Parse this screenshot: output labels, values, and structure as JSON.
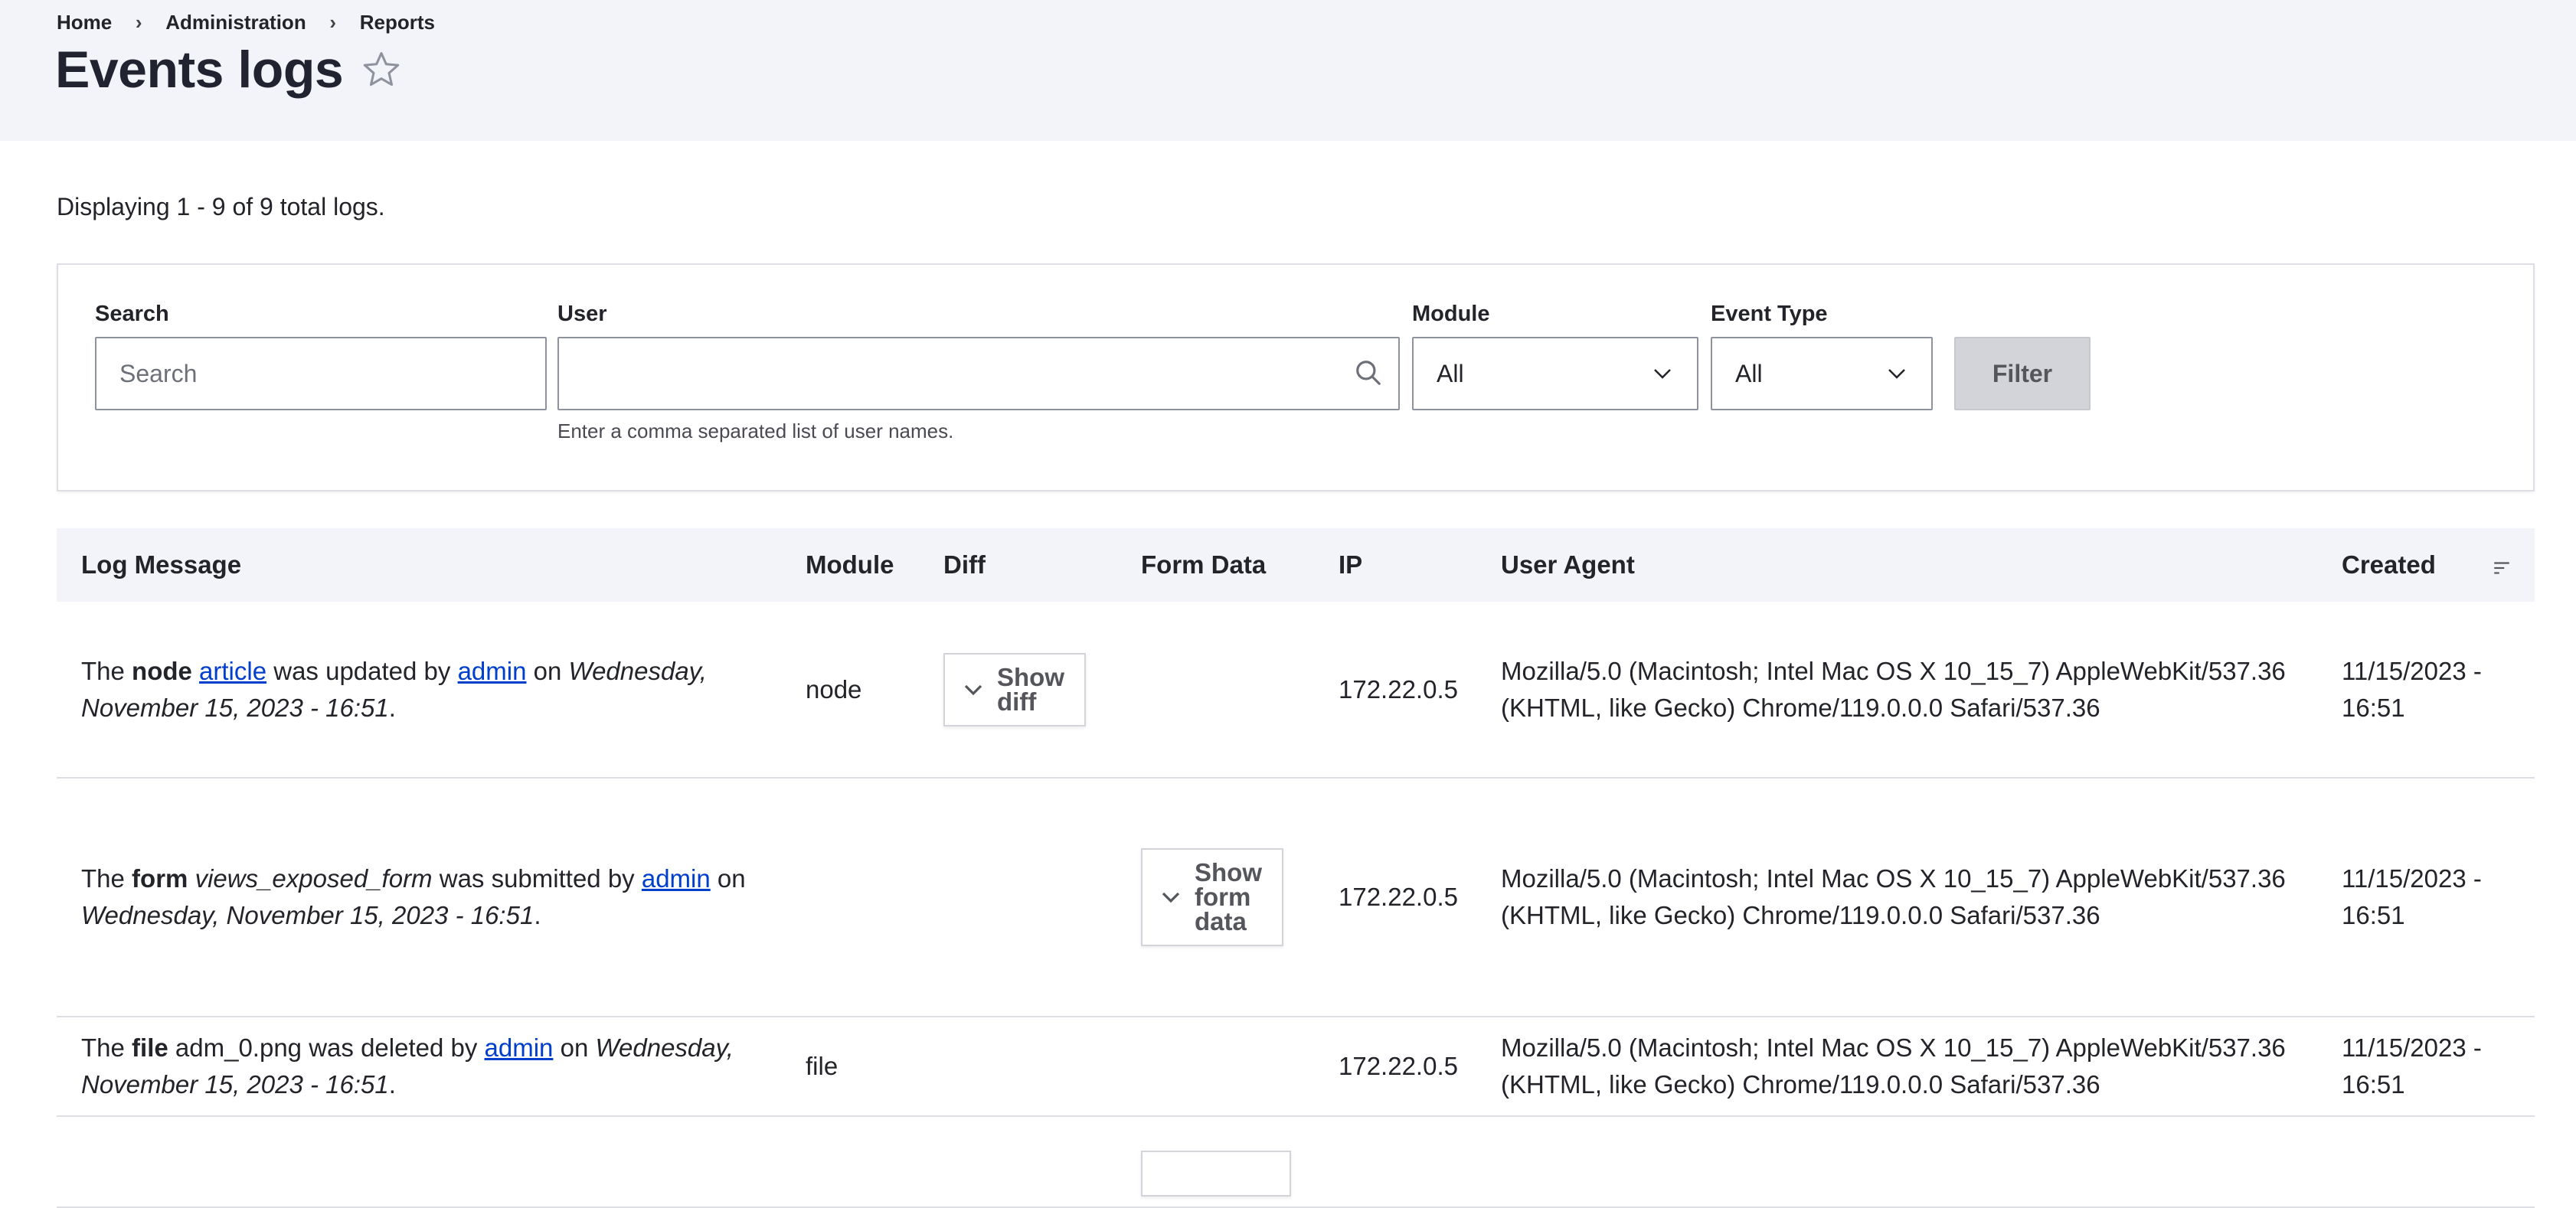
{
  "breadcrumb": [
    "Home",
    "Administration",
    "Reports"
  ],
  "page_title": "Events logs",
  "summary": "Displaying 1 - 9 of 9 total logs.",
  "filters": {
    "search": {
      "label": "Search",
      "placeholder": "Search",
      "value": ""
    },
    "user": {
      "label": "User",
      "value": "",
      "help": "Enter a comma separated list of user names."
    },
    "module": {
      "label": "Module",
      "selected": "All"
    },
    "event_type": {
      "label": "Event Type",
      "selected": "All"
    },
    "filter_button": "Filter"
  },
  "table": {
    "headers": {
      "log_message": "Log Message",
      "module": "Module",
      "diff": "Diff",
      "form_data": "Form Data",
      "ip": "IP",
      "user_agent": "User Agent",
      "created": "Created"
    },
    "rows": [
      {
        "msg": {
          "prefix": "The ",
          "type": "node",
          "subject": "article",
          "subject_is_link": true,
          "action": " was updated by ",
          "user": "admin",
          "on": " on ",
          "date": "Wednesday, November 15, 2023 - 16:51",
          "end": "."
        },
        "module": "node",
        "diff_button": "Show\ndiff",
        "form_button": "",
        "ip": "172.22.0.5",
        "user_agent": "Mozilla/5.0 (Macintosh; Intel Mac OS X 10_15_7) AppleWebKit/537.36 (KHTML, like Gecko) Chrome/119.0.0.0 Safari/537.36",
        "created": "11/15/2023 - 16:51"
      },
      {
        "msg": {
          "prefix": "The ",
          "type": "form",
          "subject": "views_exposed_form",
          "subject_is_link": false,
          "action": " was submitted by ",
          "user": "admin",
          "on": " on ",
          "date": "Wednesday, November 15, 2023 - 16:51",
          "end": "."
        },
        "module": "",
        "diff_button": "",
        "form_button": "Show\nform\ndata",
        "ip": "172.22.0.5",
        "user_agent": "Mozilla/5.0 (Macintosh; Intel Mac OS X 10_15_7) AppleWebKit/537.36 (KHTML, like Gecko) Chrome/119.0.0.0 Safari/537.36",
        "created": "11/15/2023 - 16:51"
      },
      {
        "msg": {
          "prefix": "The ",
          "type": "file",
          "subject": "adm_0.png",
          "subject_is_link": false,
          "action": " was deleted by ",
          "user": "admin",
          "on": " on ",
          "date": "Wednesday, November 15, 2023 - 16:51",
          "end": "."
        },
        "module": "file",
        "diff_button": "",
        "form_button": "",
        "ip": "172.22.0.5",
        "user_agent": "Mozilla/5.0 (Macintosh; Intel Mac OS X 10_15_7) AppleWebKit/537.36 (KHTML, like Gecko) Chrome/119.0.0.0 Safari/537.36",
        "created": "11/15/2023 - 16:51"
      }
    ]
  },
  "icons": {
    "star": "star-outline-icon",
    "search": "search-icon",
    "select_chevron": "chevron-down-icon",
    "toggle_chevron": "chevron-down-icon",
    "sort": "sort-icon"
  },
  "colors": {
    "header_bg": "#f3f4f9",
    "link": "#003ecc",
    "text": "#232429",
    "button_bg": "#d3d4d9"
  }
}
